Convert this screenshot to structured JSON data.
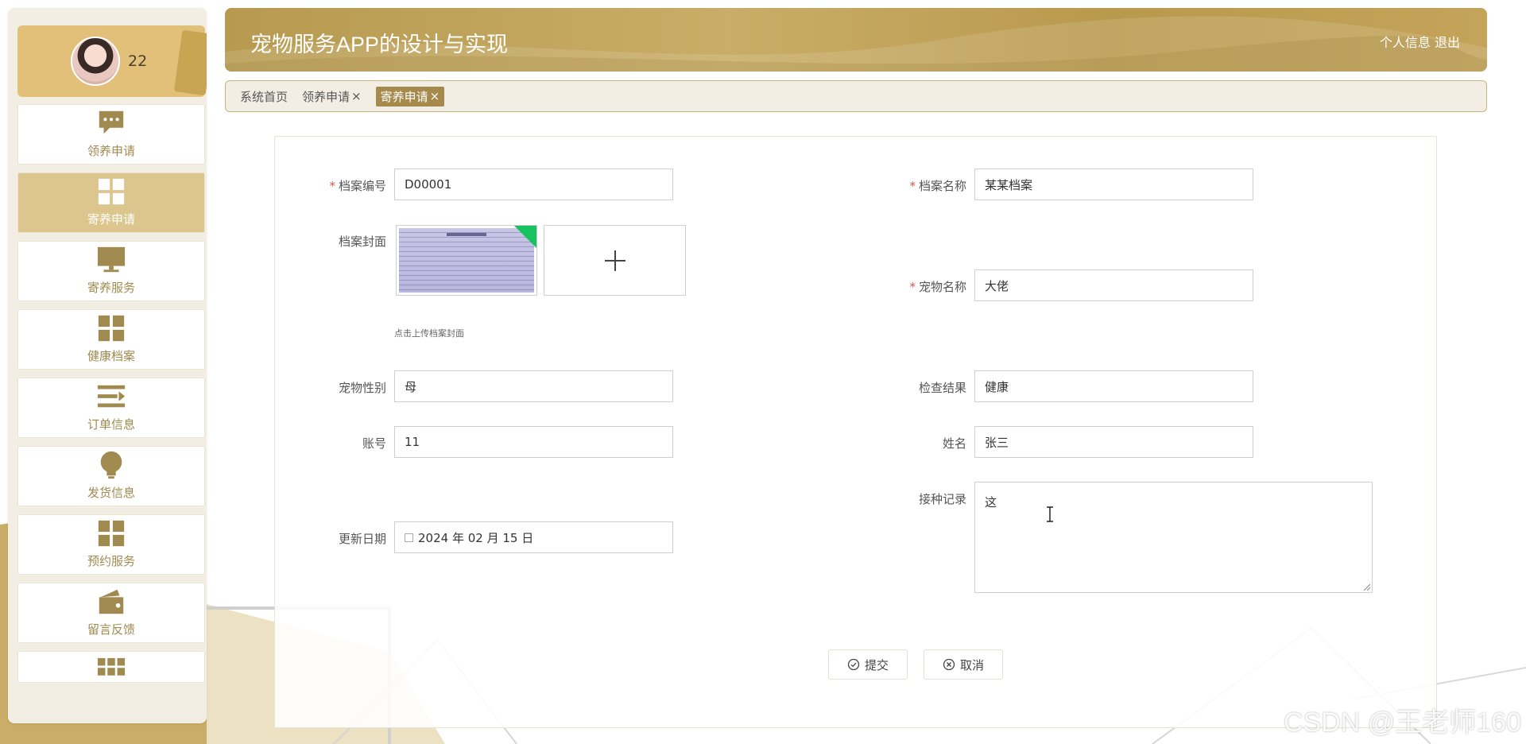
{
  "app": {
    "title": "宠物服务APP的设计与实现",
    "header_links": {
      "profile": "个人信息",
      "logout": "退出"
    }
  },
  "user": {
    "name": "22"
  },
  "sidebar": {
    "items": [
      {
        "label": "领养申请",
        "icon": "chat-bubble-icon",
        "active": false
      },
      {
        "label": "寄养申请",
        "icon": "grid-icon",
        "active": true
      },
      {
        "label": "寄养服务",
        "icon": "monitor-icon",
        "active": false
      },
      {
        "label": "健康档案",
        "icon": "grid-icon",
        "active": false
      },
      {
        "label": "订单信息",
        "icon": "list-icon",
        "active": false
      },
      {
        "label": "发货信息",
        "icon": "lightbulb-icon",
        "active": false
      },
      {
        "label": "预约服务",
        "icon": "grid-icon",
        "active": false
      },
      {
        "label": "留言反馈",
        "icon": "wallet-icon",
        "active": false
      },
      {
        "label": "",
        "icon": "apps-icon",
        "active": false
      }
    ]
  },
  "tabs": [
    {
      "label": "系统首页",
      "closable": false,
      "active": false
    },
    {
      "label": "领养申请",
      "closable": true,
      "active": false
    },
    {
      "label": "寄养申请",
      "closable": true,
      "active": true
    }
  ],
  "form": {
    "archive_no": {
      "label": "档案编号",
      "required": true,
      "value": "D00001"
    },
    "archive_name": {
      "label": "档案名称",
      "required": true,
      "value": "某某档案"
    },
    "archive_cover": {
      "label": "档案封面",
      "hint": "点击上传档案封面"
    },
    "pet_name": {
      "label": "宠物名称",
      "required": true,
      "value": "大佬"
    },
    "pet_gender": {
      "label": "宠物性别",
      "value": "母"
    },
    "check_result": {
      "label": "检查结果",
      "value": "健康"
    },
    "account": {
      "label": "账号",
      "value": "11"
    },
    "real_name": {
      "label": "姓名",
      "value": "张三"
    },
    "vaccination": {
      "label": "接种记录",
      "value": "这"
    },
    "update_date": {
      "label": "更新日期",
      "value": "2024 年 02 月 15 日"
    }
  },
  "buttons": {
    "submit": "提交",
    "cancel": "取消"
  },
  "watermark": "CSDN @王老师160",
  "colors": {
    "accent": "#b79a4f",
    "active_nav": "#dcc68d",
    "required": "#d9534f",
    "upload_badge": "#16c35f"
  }
}
